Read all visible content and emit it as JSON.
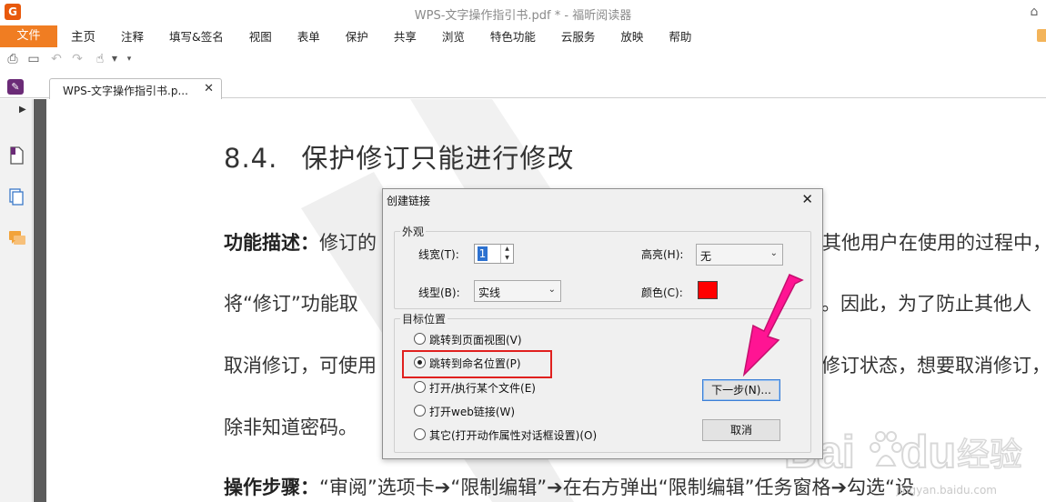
{
  "window": {
    "title": "WPS-文字操作指引书.pdf * - 福昕阅读器",
    "logo_letter": "G"
  },
  "menu": {
    "file": "文件",
    "items": [
      "主页",
      "注释",
      "填写&签名",
      "视图",
      "表单",
      "保护",
      "共享",
      "浏览",
      "特色功能",
      "云服务",
      "放映",
      "帮助"
    ]
  },
  "tab": {
    "label": "WPS-文字操作指引书.p...",
    "close": "✕"
  },
  "document": {
    "heading_num": "8.4.",
    "heading_text": "保护修订只能进行修改",
    "para1_bold": "功能描述：",
    "para1_text": "修订的",
    "para1_right": "其他用户在使用的过程中，",
    "para2_left": "将“修订”功能取",
    "para2_right": "。因此，为了防止其他人",
    "para3_left": "取消修订，可使用",
    "para3_right": "修订状态，想要取消修订，",
    "para4": "除非知道密码。",
    "para5_bold": "操作步骤：",
    "para5_text": "“审阅”选项卡➔“限制编辑”➔在右方弹出“限制编辑”任务窗格➔勾选“设"
  },
  "watermark": {
    "brand": "Bai",
    "brand2": "du",
    "brand_cn": "经验",
    "url": "jingyan.baidu.com"
  },
  "dialog": {
    "title": "创建链接",
    "close": "✕",
    "appearance": {
      "legend": "外观",
      "line_width_label": "线宽(T):",
      "line_width_value": "1",
      "highlight_label": "高亮(H):",
      "highlight_value": "无",
      "line_style_label": "线型(B):",
      "line_style_value": "实线",
      "color_label": "颜色(C):",
      "color_value": "#ff0000"
    },
    "target": {
      "legend": "目标位置",
      "options": [
        {
          "label": "跳转到页面视图(V)",
          "checked": false
        },
        {
          "label": "跳转到命名位置(P)",
          "checked": true
        },
        {
          "label": "打开/执行某个文件(E)",
          "checked": false
        },
        {
          "label": "打开web链接(W)",
          "checked": false
        },
        {
          "label": "其它(打开动作属性对话框设置)(O)",
          "checked": false
        }
      ]
    },
    "next_button": "下一步(N)...",
    "cancel_button": "取消"
  },
  "colors": {
    "accent": "#f07d22",
    "annotation_arrow": "#ff1493",
    "highlight_box": "#e0201e"
  }
}
